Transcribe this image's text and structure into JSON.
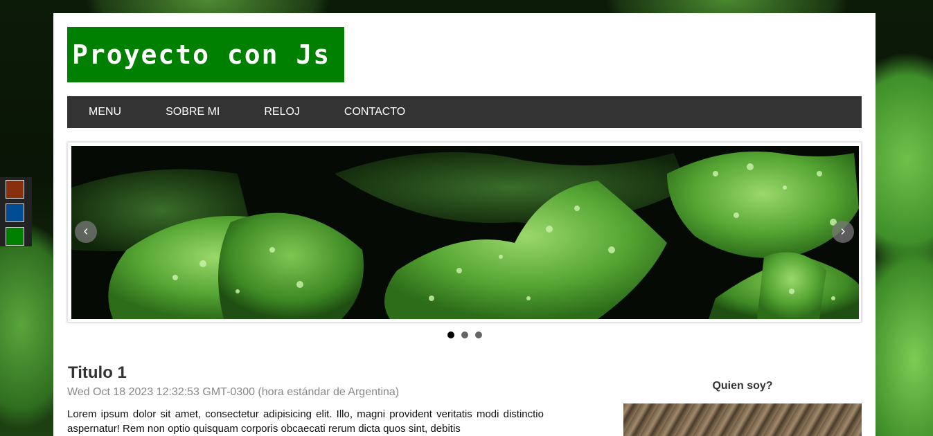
{
  "header": {
    "logo_text": "Proyecto con Js"
  },
  "theme_switcher": {
    "colors": [
      "#882f0d",
      "#004c94",
      "#008000"
    ]
  },
  "nav": {
    "items": [
      {
        "label": "MENU"
      },
      {
        "label": "SOBRE MI"
      },
      {
        "label": "RELOJ"
      },
      {
        "label": "CONTACTO"
      }
    ]
  },
  "slider": {
    "prev_icon": "chevron-left-icon",
    "next_icon": "chevron-right-icon",
    "dots": 3,
    "active_dot": 1
  },
  "article": {
    "title": "Titulo 1",
    "date": "Wed Oct 18 2023 12:32:53 GMT-0300 (hora estándar de Argentina)",
    "body": "Lorem ipsum dolor sit amet, consectetur adipisicing elit. Illo, magni provident veritatis modi distinctio aspernatur! Rem non optio quisquam corporis obcaecati rerum dicta quos sint, debitis"
  },
  "aside": {
    "title": "Quien soy?"
  }
}
